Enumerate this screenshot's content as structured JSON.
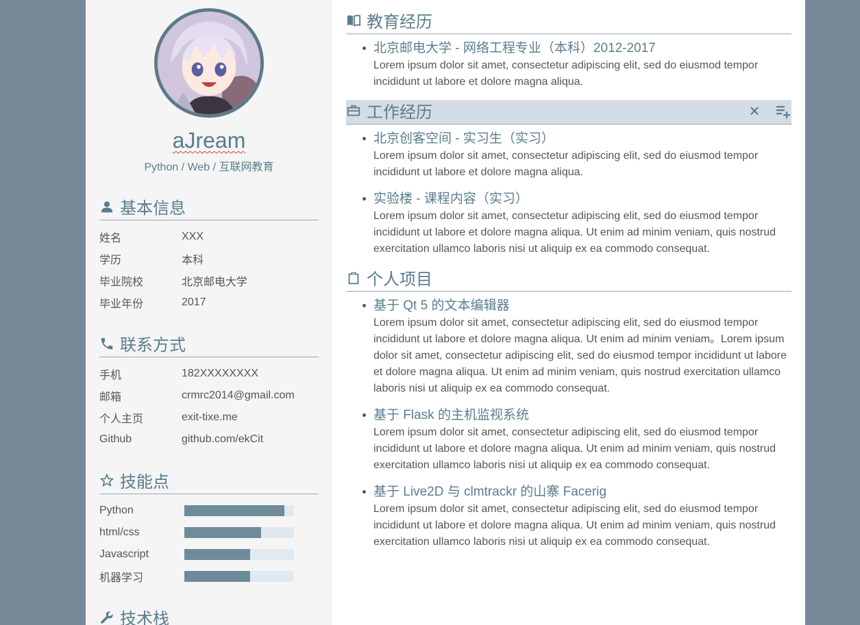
{
  "profile": {
    "name": "aJream",
    "tagline": "Python / Web / 互联网教育"
  },
  "basic_info": {
    "title": "基本信息",
    "rows": [
      {
        "label": "姓名",
        "value": "XXX"
      },
      {
        "label": "学历",
        "value": "本科"
      },
      {
        "label": "毕业院校",
        "value": "北京邮电大学"
      },
      {
        "label": "毕业年份",
        "value": "2017"
      }
    ]
  },
  "contact": {
    "title": "联系方式",
    "rows": [
      {
        "label": "手机",
        "value": "182XXXXXXXX"
      },
      {
        "label": "邮箱",
        "value": "crmrc2014@gmail.com"
      },
      {
        "label": "个人主页",
        "value": "exit-tixe.me"
      },
      {
        "label": "Github",
        "value": "github.com/ekCit"
      }
    ]
  },
  "skills": {
    "title": "技能点",
    "rows": [
      {
        "label": "Python",
        "level": 0.91
      },
      {
        "label": "html/css",
        "level": 0.7
      },
      {
        "label": "Javascript",
        "level": 0.6
      },
      {
        "label": "机器学习",
        "level": 0.6
      }
    ]
  },
  "tech_stack": {
    "title": "技术栈"
  },
  "education": {
    "title": "教育经历",
    "entries": [
      {
        "title": "北京邮电大学 - 网络工程专业（本科）2012-2017",
        "desc": "Lorem ipsum dolor sit amet, consectetur adipiscing elit, sed do eiusmod tempor incididunt ut labore et dolore magna aliqua."
      }
    ]
  },
  "work": {
    "title": "工作经历",
    "entries": [
      {
        "title": "北京创客空间 - 实习生（实习）",
        "desc": "Lorem ipsum dolor sit amet, consectetur adipiscing elit, sed do eiusmod tempor incididunt ut labore et dolore magna aliqua."
      },
      {
        "title": "实验楼 - 课程内容（实习）",
        "desc": "Lorem ipsum dolor sit amet, consectetur adipiscing elit, sed do eiusmod tempor incididunt ut labore et dolore magna aliqua. Ut enim ad minim veniam, quis nostrud exercitation ullamco laboris nisi ut aliquip ex ea commodo consequat."
      }
    ]
  },
  "projects": {
    "title": "个人项目",
    "entries": [
      {
        "title": "基于 Qt 5 的文本编辑器",
        "desc": "Lorem ipsum dolor sit amet, consectetur adipiscing elit, sed do eiusmod tempor incididunt ut labore et dolore magna aliqua. Ut enim ad minim veniam。Lorem ipsum dolor sit amet, consectetur adipiscing elit, sed do eiusmod tempor incididunt ut labore et dolore magna aliqua. Ut enim ad minim veniam, quis nostrud exercitation ullamco laboris nisi ut aliquip ex ea commodo consequat."
      },
      {
        "title": "基于 Flask 的主机监视系统",
        "desc": "Lorem ipsum dolor sit amet, consectetur adipiscing elit, sed do eiusmod tempor incididunt ut labore et dolore magna aliqua. Ut enim ad minim veniam, quis nostrud exercitation ullamco laboris nisi ut aliquip ex ea commodo consequat."
      },
      {
        "title": "基于 Live2D 与 clmtrackr 的山寨 Facerig",
        "desc": "Lorem ipsum dolor sit amet, consectetur adipiscing elit, sed do eiusmod tempor incididunt ut labore et dolore magna aliqua. Ut enim ad minim veniam, quis nostrud exercitation ullamco laboris nisi ut aliquip ex ea commodo consequat."
      }
    ]
  },
  "colors": {
    "background": "#778899",
    "accent": "#5a7d8c",
    "bar_fill": "#6f8a99",
    "bar_track": "#e0e9f0",
    "hover_header": "#d5dde4"
  }
}
